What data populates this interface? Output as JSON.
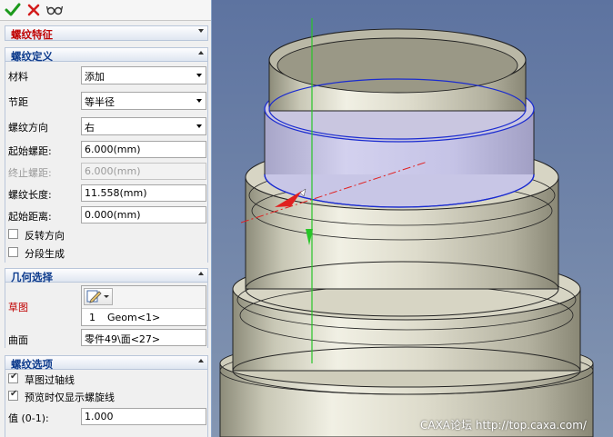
{
  "toolbar": {
    "confirm_icon": "checkmark-icon",
    "cancel_icon": "close-icon",
    "preview_icon": "glasses-icon"
  },
  "feature_title": "螺纹特征",
  "definition": {
    "title": "螺纹定义",
    "material": {
      "label": "材料",
      "value": "添加"
    },
    "pitch": {
      "label": "节距",
      "value": "等半径"
    },
    "direction": {
      "label": "螺纹方向",
      "value": "右"
    },
    "start_pitch": {
      "label": "起始螺距:",
      "value": "6.000(mm)"
    },
    "end_pitch": {
      "label": "终止螺距:",
      "value": "6.000(mm)"
    },
    "length": {
      "label": "螺纹长度:",
      "value": "11.558(mm)"
    },
    "start_distance": {
      "label": "起始距离:",
      "value": "0.000(mm)"
    },
    "reverse": {
      "label": "反转方向",
      "checked": false
    },
    "segmented": {
      "label": "分段生成",
      "checked": false
    }
  },
  "geometry": {
    "title": "几何选择",
    "sketch_label": "草图",
    "sketch_index": "1",
    "sketch_value": "Geom<1>",
    "surface_label": "曲面",
    "surface_value": "零件49\\面<27>"
  },
  "options": {
    "title": "螺纹选项",
    "sketch_axis": {
      "label": "草图过轴线",
      "checked": true
    },
    "preview_helix": {
      "label": "预览时仅显示螺旋线",
      "checked": true
    },
    "value": {
      "label": "值 (0-1):",
      "value": "1.000"
    }
  },
  "watermark": "CAXA论坛 http://top.caxa.com/",
  "colors": {
    "accent_red": "#c00000",
    "header_blue": "#0c3a8c",
    "viewport_bg": "#6f84a6",
    "part_metal": "#d8d6c6",
    "thread_highlight": "#b9b6e2"
  }
}
